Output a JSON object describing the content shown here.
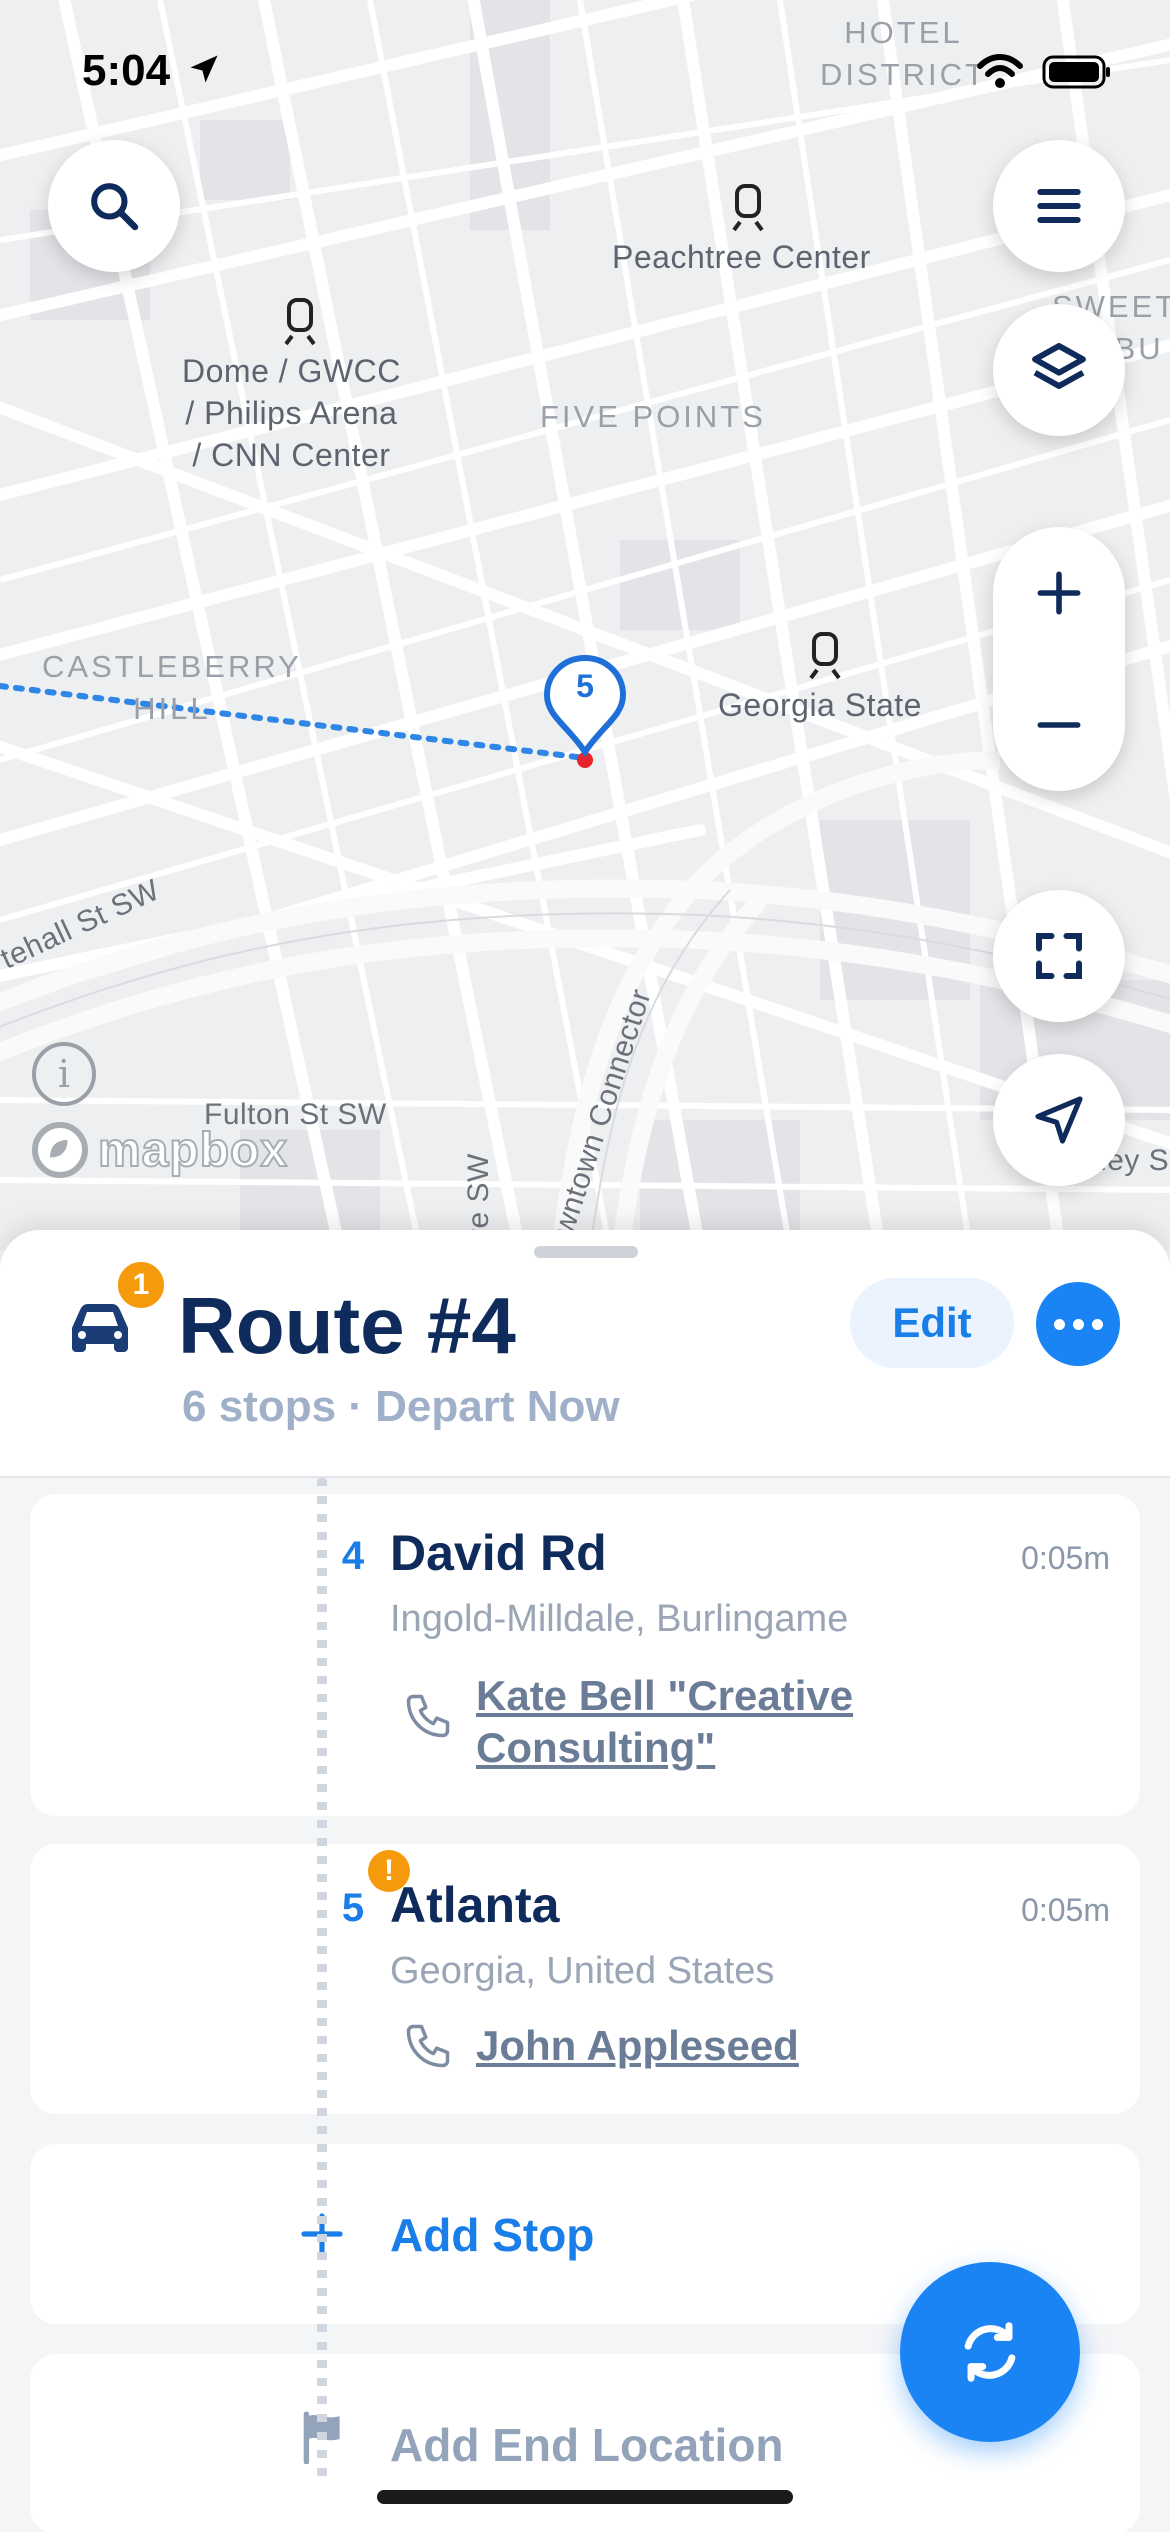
{
  "status_bar": {
    "time": "5:04"
  },
  "map": {
    "labels": {
      "hotel_district": "HOTEL\nDISTRICT",
      "peachtree_center": "Peachtree Center",
      "sweet_auburn": "SWEET\nAUBU",
      "dome": "Dome / GWCC\n/ Philips Arena\n/ CNN Center",
      "five_points": "FIVE POINTS",
      "castleberry": "CASTLEBERRY\nHILL",
      "georgia_state": "Georgia State",
      "whitehall": "tehall St SW",
      "fulton": "Fulton St SW",
      "connector": "owntown Connector",
      "ve_sw": "ve SW",
      "ley_s": "ley S"
    },
    "pin_number": "5",
    "attribution": "mapbox",
    "controls": [
      "search-icon",
      "menu-icon",
      "layers-icon",
      "zoom-in-icon",
      "zoom-out-icon",
      "fit-bounds-icon",
      "locate-icon"
    ]
  },
  "route": {
    "badge_count": "1",
    "title": "Route #4",
    "subtitle": "6 stops · Depart Now",
    "edit_label": "Edit",
    "stops": [
      {
        "number": "4",
        "name": "David Rd",
        "time": "0:05m",
        "address": "Ingold-Milldale, Burlingame",
        "contact": "Kate Bell \"Creative Consulting\"",
        "warning": false
      },
      {
        "number": "5",
        "name": "Atlanta",
        "time": "0:05m",
        "address": "Georgia, United States",
        "contact": "John Appleseed",
        "warning": true,
        "warning_glyph": "!"
      }
    ],
    "add_stop_label": "Add Stop",
    "add_end_label": "Add End Location"
  },
  "colors": {
    "accent": "#1a84f5",
    "title": "#0f2b5b",
    "warning": "#f59a0b"
  }
}
